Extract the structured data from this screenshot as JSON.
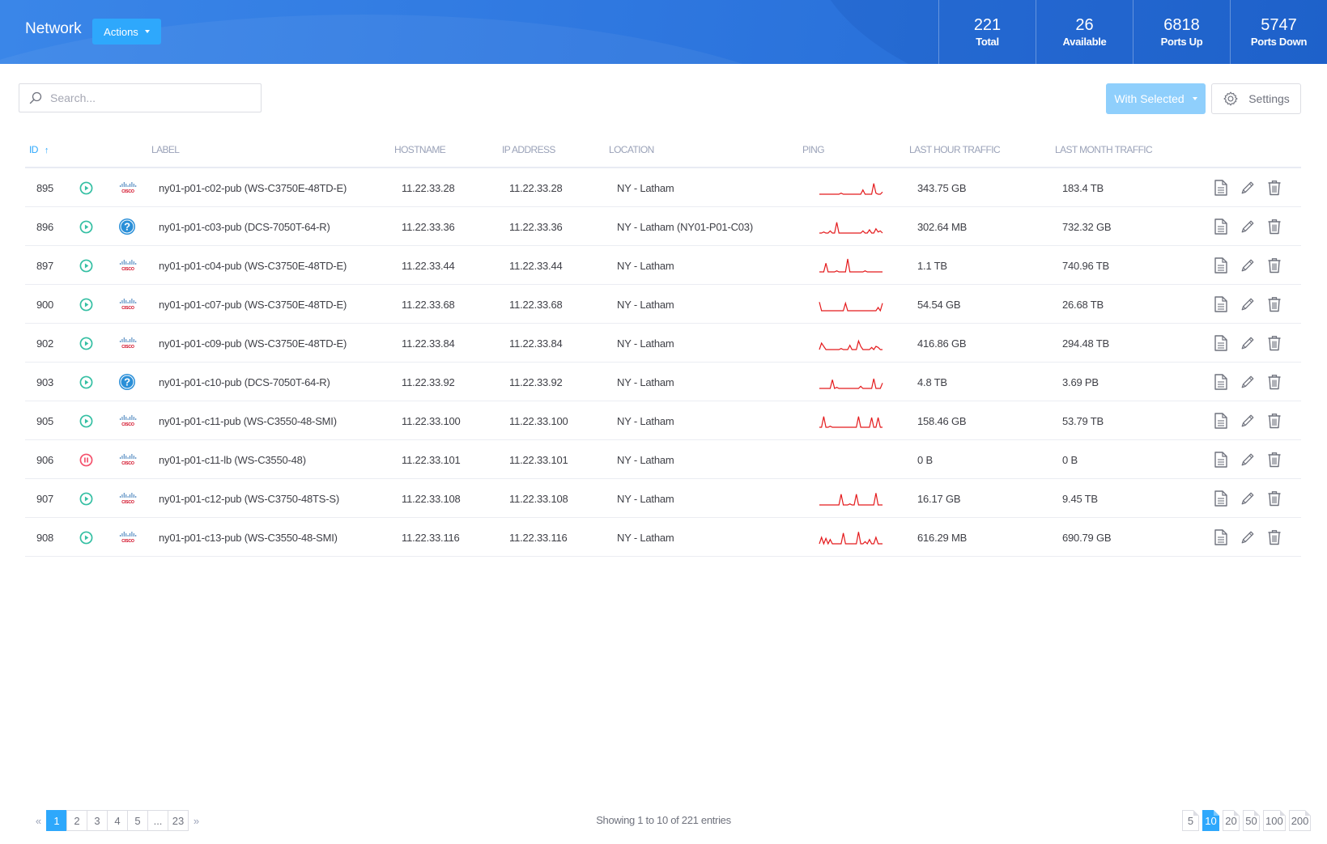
{
  "header": {
    "title": "Network",
    "actions_label": "Actions",
    "stats": [
      {
        "value": "221",
        "label": "Total"
      },
      {
        "value": "26",
        "label": "Available"
      },
      {
        "value": "6818",
        "label": "Ports Up"
      },
      {
        "value": "5747",
        "label": "Ports Down"
      }
    ]
  },
  "toolbar": {
    "search_placeholder": "Search...",
    "search_value": "",
    "with_selected_label": "With Selected",
    "settings_label": "Settings"
  },
  "table": {
    "columns": {
      "id": "ID",
      "label": "LABEL",
      "hostname": "HOSTNAME",
      "ip": "IP ADDRESS",
      "location": "LOCATION",
      "ping": "PING",
      "last_hour": "LAST HOUR TRAFFIC",
      "last_month": "LAST MONTH TRAFFIC"
    },
    "sort": {
      "column": "id",
      "direction": "ascending"
    },
    "rows": [
      {
        "id": "895",
        "status": "up",
        "vendor": "cisco",
        "label": "ny01-p01-c02-pub (WS-C3750E-48TD-E)",
        "hostname": "11.22.33.28",
        "ip": "11.22.33.28",
        "location": "NY - Latham",
        "ping": [
          0,
          0,
          0,
          0,
          0,
          0,
          0,
          0,
          0,
          0,
          1,
          0,
          0,
          0,
          0,
          0,
          0,
          0,
          0,
          0,
          4,
          0,
          0,
          0,
          0,
          10,
          1,
          0,
          0,
          2
        ],
        "last_hour": "343.75 GB",
        "last_month": "183.4 TB"
      },
      {
        "id": "896",
        "status": "up",
        "vendor": "unknown",
        "label": "ny01-p01-c03-pub (DCS-7050T-64-R)",
        "hostname": "11.22.33.36",
        "ip": "11.22.33.36",
        "location": "NY - Latham (NY01-P01-C03)",
        "ping": [
          0,
          0,
          1,
          0,
          0,
          2,
          0,
          0,
          10,
          0,
          0,
          0,
          0,
          0,
          0,
          0,
          0,
          0,
          0,
          0,
          2,
          0,
          0,
          3,
          0,
          0,
          4,
          1,
          2,
          0
        ],
        "last_hour": "302.64 MB",
        "last_month": "732.32 GB"
      },
      {
        "id": "897",
        "status": "up",
        "vendor": "cisco",
        "label": "ny01-p01-c04-pub (WS-C3750E-48TD-E)",
        "hostname": "11.22.33.44",
        "ip": "11.22.33.44",
        "location": "NY - Latham",
        "ping": [
          0,
          0,
          0,
          8,
          0,
          0,
          0,
          0,
          1,
          0,
          0,
          0,
          0,
          12,
          0,
          0,
          0,
          0,
          0,
          0,
          0,
          1,
          0,
          0,
          0,
          0,
          0,
          0,
          0,
          0
        ],
        "last_hour": "1.1 TB",
        "last_month": "740.96 TB"
      },
      {
        "id": "900",
        "status": "up",
        "vendor": "cisco",
        "label": "ny01-p01-c07-pub (WS-C3750E-48TD-E)",
        "hostname": "11.22.33.68",
        "ip": "11.22.33.68",
        "location": "NY - Latham",
        "ping": [
          8,
          0,
          0,
          0,
          0,
          0,
          0,
          0,
          0,
          0,
          0,
          0,
          7,
          0,
          0,
          0,
          0,
          0,
          0,
          0,
          0,
          0,
          0,
          0,
          0,
          0,
          0,
          3,
          0,
          7
        ],
        "last_hour": "54.54 GB",
        "last_month": "26.68 TB"
      },
      {
        "id": "902",
        "status": "up",
        "vendor": "cisco",
        "label": "ny01-p01-c09-pub (WS-C3750E-48TD-E)",
        "hostname": "11.22.33.84",
        "ip": "11.22.33.84",
        "location": "NY - Latham",
        "ping": [
          0,
          6,
          3,
          0,
          0,
          0,
          0,
          0,
          0,
          0,
          1,
          0,
          0,
          0,
          4,
          0,
          0,
          0,
          8,
          3,
          0,
          0,
          0,
          0,
          2,
          0,
          3,
          2,
          0,
          0
        ],
        "last_hour": "416.86 GB",
        "last_month": "294.48 TB"
      },
      {
        "id": "903",
        "status": "up",
        "vendor": "unknown",
        "label": "ny01-p01-c10-pub (DCS-7050T-64-R)",
        "hostname": "11.22.33.92",
        "ip": "11.22.33.92",
        "location": "NY - Latham",
        "ping": [
          0,
          0,
          0,
          0,
          0,
          0,
          8,
          0,
          1,
          0,
          0,
          0,
          0,
          0,
          0,
          0,
          0,
          0,
          0,
          2,
          0,
          0,
          0,
          0,
          0,
          9,
          0,
          0,
          0,
          5
        ],
        "last_hour": "4.8 TB",
        "last_month": "3.69 PB"
      },
      {
        "id": "905",
        "status": "up",
        "vendor": "cisco",
        "label": "ny01-p01-c11-pub (WS-C3550-48-SMI)",
        "hostname": "11.22.33.100",
        "ip": "11.22.33.100",
        "location": "NY - Latham",
        "ping": [
          0,
          0,
          10,
          0,
          0,
          1,
          0,
          0,
          0,
          0,
          0,
          0,
          0,
          0,
          0,
          0,
          0,
          0,
          10,
          0,
          0,
          0,
          0,
          0,
          9,
          0,
          0,
          9,
          0,
          0
        ],
        "last_hour": "158.46 GB",
        "last_month": "53.79 TB"
      },
      {
        "id": "906",
        "status": "paused",
        "vendor": "cisco",
        "label": "ny01-p01-c11-lb (WS-C3550-48)",
        "hostname": "11.22.33.101",
        "ip": "11.22.33.101",
        "location": "NY - Latham",
        "ping": [],
        "last_hour": "0 B",
        "last_month": "0 B"
      },
      {
        "id": "907",
        "status": "up",
        "vendor": "cisco",
        "label": "ny01-p01-c12-pub (WS-C3750-48TS-S)",
        "hostname": "11.22.33.108",
        "ip": "11.22.33.108",
        "location": "NY - Latham",
        "ping": [
          0,
          0,
          0,
          0,
          0,
          0,
          0,
          0,
          0,
          0,
          10,
          0,
          0,
          0,
          1,
          0,
          0,
          10,
          0,
          0,
          0,
          0,
          0,
          0,
          0,
          0,
          11,
          0,
          0,
          0
        ],
        "last_hour": "16.17 GB",
        "last_month": "9.45 TB"
      },
      {
        "id": "908",
        "status": "up",
        "vendor": "cisco",
        "label": "ny01-p01-c13-pub (WS-C3550-48-SMI)",
        "hostname": "11.22.33.116",
        "ip": "11.22.33.116",
        "location": "NY - Latham",
        "ping": [
          0,
          6,
          0,
          5,
          0,
          4,
          0,
          0,
          0,
          0,
          0,
          10,
          0,
          0,
          0,
          0,
          0,
          0,
          11,
          0,
          0,
          2,
          0,
          4,
          0,
          0,
          6,
          0,
          0,
          0
        ],
        "last_hour": "616.29 MB",
        "last_month": "690.79 GB"
      }
    ]
  },
  "colors": {
    "accent": "#2ea8fc",
    "status_up": "#34bfa3",
    "status_paused": "#f4516c",
    "unknown_vendor": "#2a8fd8",
    "cisco_red": "#d0021b",
    "ping_line": "#e41a1c"
  },
  "footer": {
    "pages": [
      "1",
      "2",
      "3",
      "4",
      "5",
      "...",
      "23"
    ],
    "current_page": "1",
    "info": "Showing 1 to 10 of 221 entries",
    "page_sizes": [
      "5",
      "10",
      "20",
      "50",
      "100",
      "200"
    ],
    "current_page_size": "10"
  }
}
